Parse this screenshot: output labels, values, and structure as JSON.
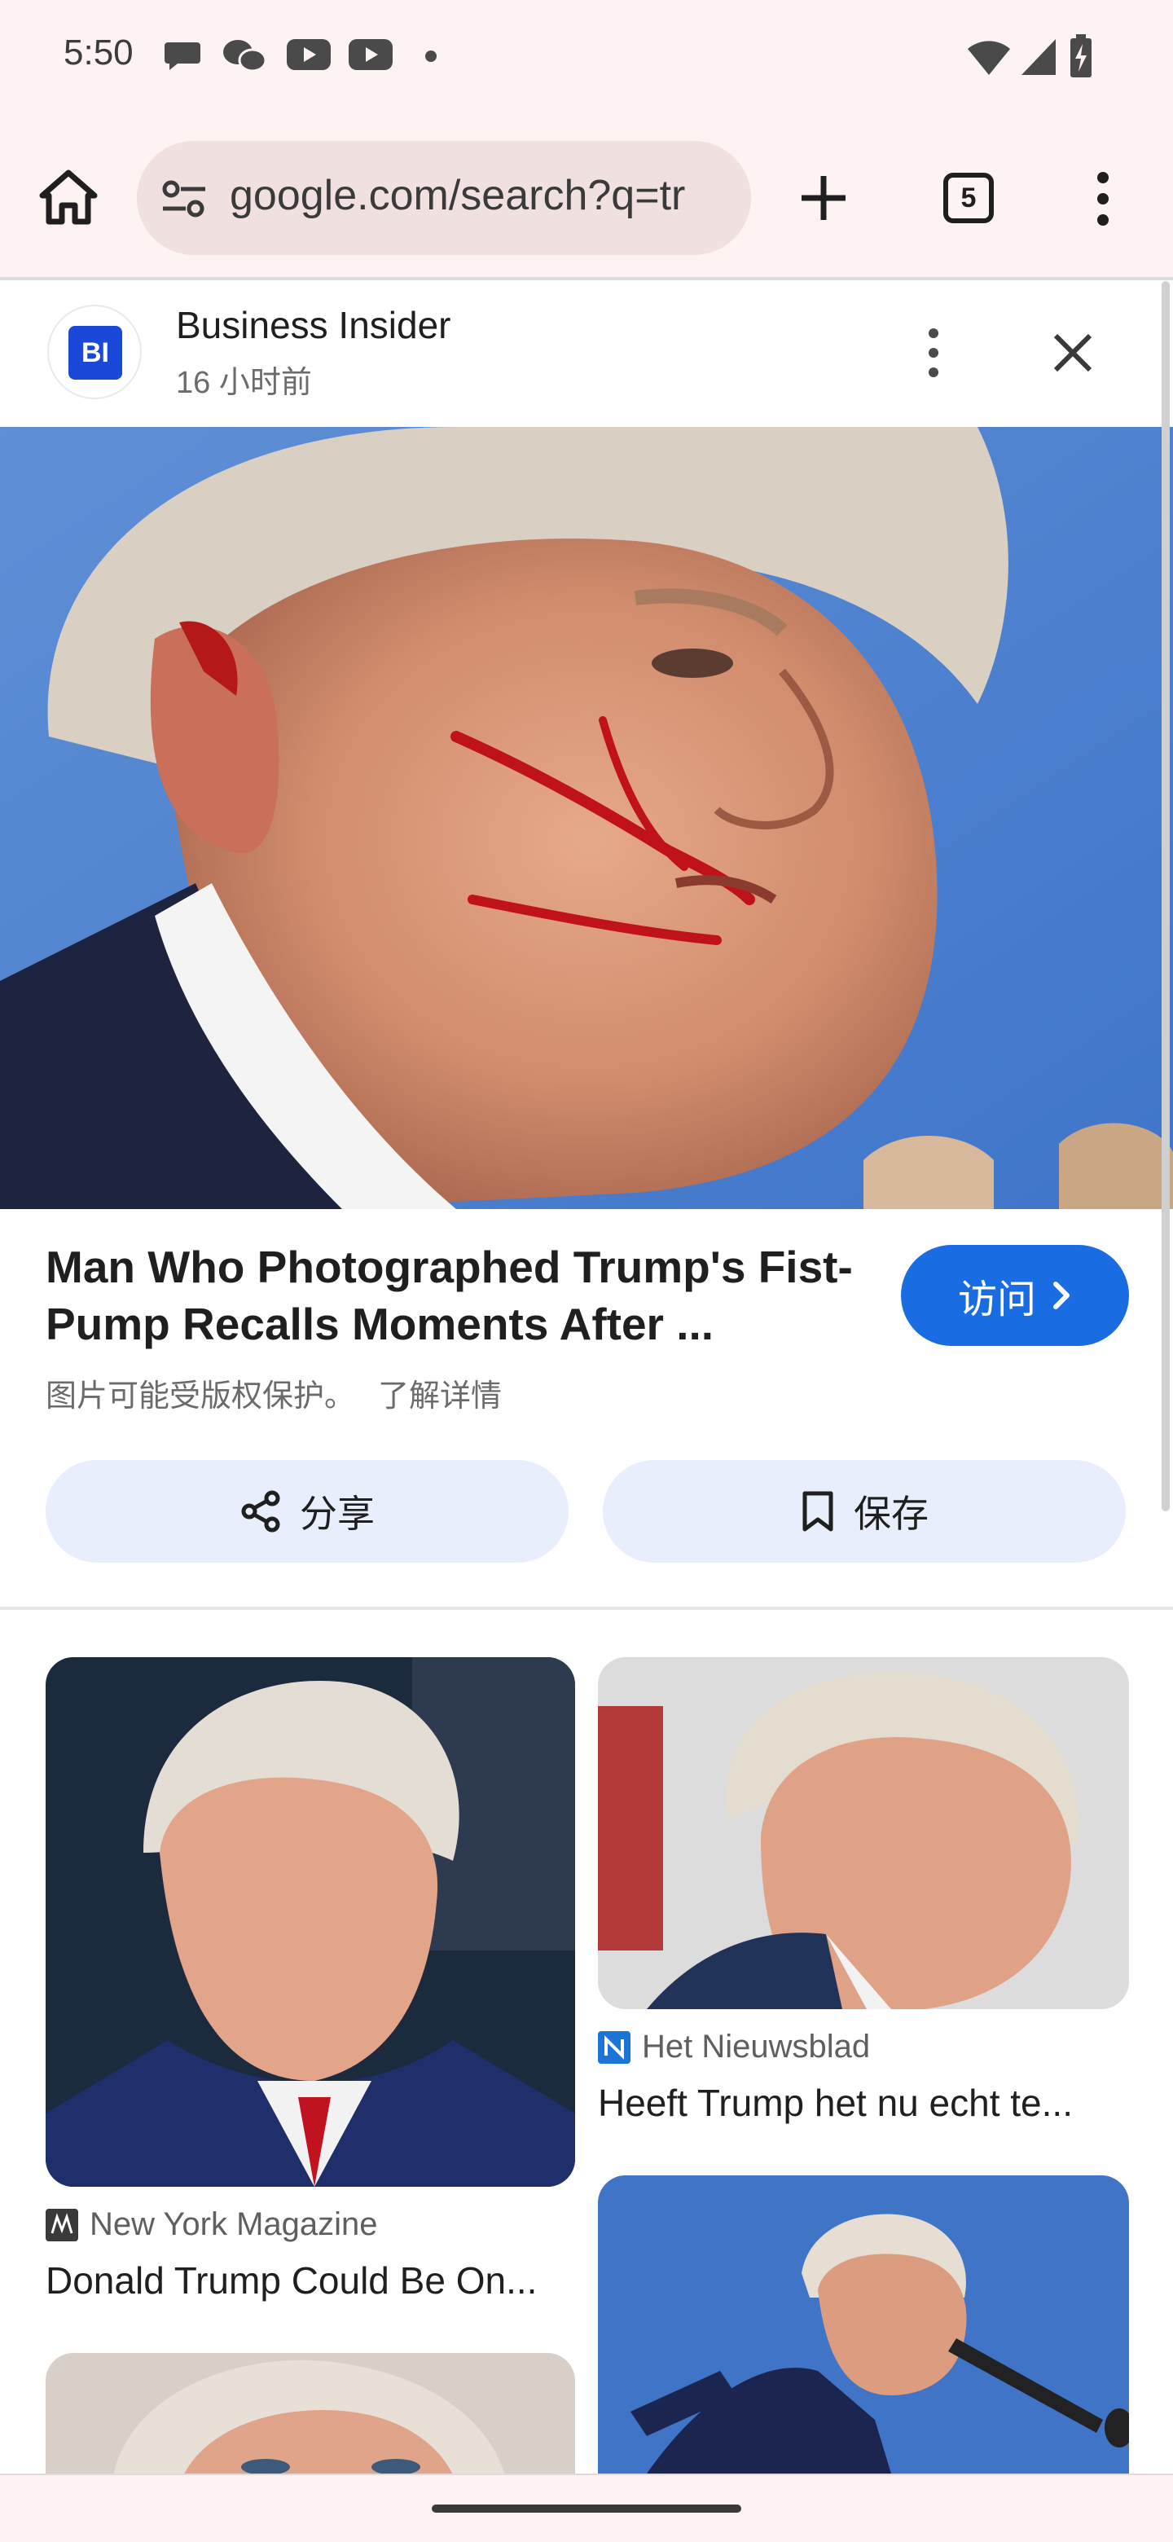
{
  "status_bar": {
    "time": "5:50"
  },
  "browser": {
    "url": "google.com/search?q=tr",
    "tab_count": "5"
  },
  "source": {
    "logo_text": "BI",
    "name": "Business Insider",
    "time_ago": "16 小时前"
  },
  "article": {
    "title": "Man Who Photographed Trump's Fist-Pump Recalls Moments After ...",
    "visit_label": "访问",
    "copyright_notice": "图片可能受版权保护。",
    "learn_more": "了解详情"
  },
  "actions": {
    "share_label": "分享",
    "save_label": "保存"
  },
  "results": [
    {
      "source": "New York Magazine",
      "title": "Donald Trump Could Be On..."
    },
    {
      "source": "Het Nieuwsblad",
      "title": "Heeft Trump het nu echt te..."
    }
  ],
  "colors": {
    "accent": "#1a6ce3",
    "status_bar_bg": "#fcf3f2",
    "url_pill_bg": "#f0e0df",
    "action_button_bg": "#e8eefb",
    "source_logo_bg": "#1a48d8"
  }
}
